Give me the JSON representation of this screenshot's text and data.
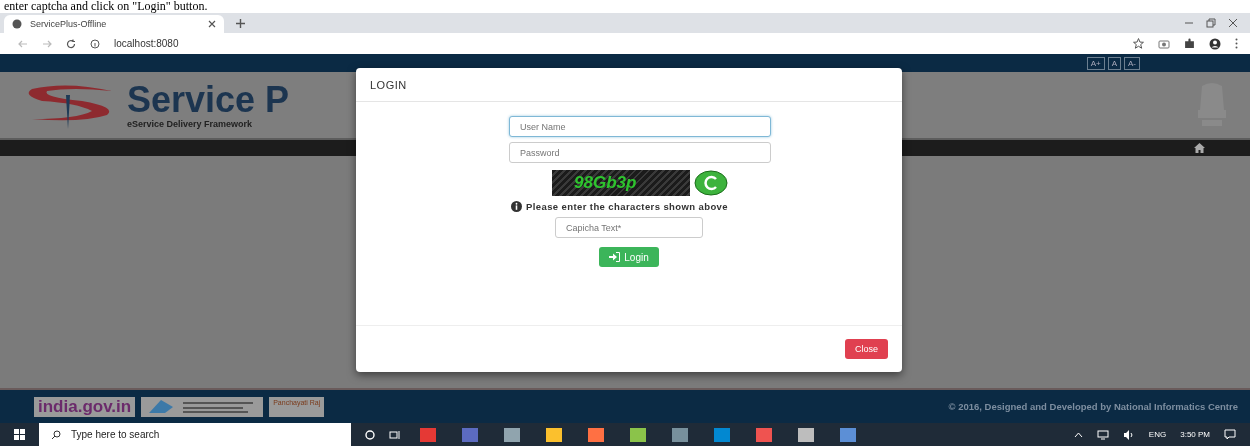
{
  "caption": "enter captcha and click on \"Login\" button.",
  "browser": {
    "tab_title": "ServicePlus-Offline",
    "url": "localhost:8080"
  },
  "font_buttons": [
    "A+",
    "A",
    "A-"
  ],
  "header": {
    "logo_title": "Service P",
    "logo_subtitle": "eService Delivery Framework"
  },
  "modal": {
    "title": "LOGIN",
    "username": {
      "placeholder": "User Name"
    },
    "password": {
      "placeholder": "Password"
    },
    "captcha": "98Gb3p",
    "hint": "Please enter the characters shown above",
    "captcha_field": {
      "placeholder": "Capicha Text*"
    },
    "login_button": "Login",
    "close_button": "Close"
  },
  "footer": {
    "logos": [
      {
        "kind": "india",
        "label": "india.gov.in"
      },
      {
        "kind": "nic"
      },
      {
        "kind": "panchayat",
        "label": "Panchayati Raj"
      }
    ],
    "copyright": "© 2016, Designed and Developed by National Informatics Centre"
  },
  "taskbar": {
    "search_placeholder": "Type here to search",
    "apps": [
      {
        "color": "#e53935"
      },
      {
        "color": "#5c6bc0"
      },
      {
        "color": "#90a4ae"
      },
      {
        "color": "#fbc02d"
      },
      {
        "color": "#ff7043"
      },
      {
        "color": "#8bc34a"
      },
      {
        "color": "#78909c"
      },
      {
        "color": "#0288d1"
      },
      {
        "color": "#ef5350"
      },
      {
        "color": "#bdbdbd"
      },
      {
        "color": "#5c8fd6"
      }
    ],
    "lang": "ENG",
    "time": "3:50 PM"
  }
}
